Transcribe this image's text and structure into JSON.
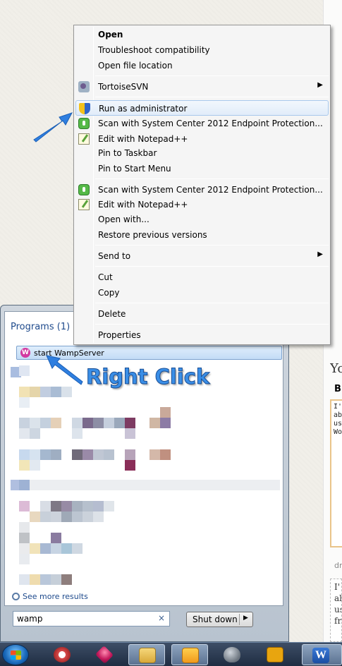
{
  "context_menu": {
    "items": [
      {
        "label": "Open",
        "bold": true,
        "icon": null
      },
      {
        "label": "Troubleshoot compatibility",
        "icon": null
      },
      {
        "label": "Open file location",
        "icon": null
      },
      {
        "label": "TortoiseSVN",
        "icon": "tortoisesvn-icon",
        "submenu": "▶"
      },
      {
        "label": "Run as administrator",
        "icon": "uac-shield-icon",
        "highlighted": true
      },
      {
        "label": "Scan with System Center 2012 Endpoint Protection...",
        "icon": "scep-icon"
      },
      {
        "label": "Edit with Notepad++",
        "icon": "notepadpp-icon"
      },
      {
        "label": "Pin to Taskbar",
        "icon": null
      },
      {
        "label": "Pin to Start Menu",
        "icon": null
      },
      {
        "label": "Scan with System Center 2012 Endpoint Protection...",
        "icon": "scep-icon"
      },
      {
        "label": "Edit with Notepad++",
        "icon": "notepadpp-icon"
      },
      {
        "label": "Open with...",
        "icon": null
      },
      {
        "label": "Restore previous versions",
        "icon": null
      },
      {
        "label": "Send to",
        "icon": null,
        "submenu": "▶"
      },
      {
        "label": "Cut",
        "icon": null
      },
      {
        "label": "Copy",
        "icon": null
      },
      {
        "label": "Delete",
        "icon": null
      },
      {
        "label": "Properties",
        "icon": null
      }
    ]
  },
  "start_menu": {
    "programs_heading": "Programs (1)",
    "result_label": "start WampServer",
    "see_more": "See more results",
    "search_value": "wamp",
    "clear_glyph": "×",
    "shutdown_label": "Shut down",
    "shutdown_arrow": "▶"
  },
  "annotation": {
    "label": "Right Click"
  },
  "right_page": {
    "title": "Yo",
    "bold": "B",
    "code_lines": [
      "I'",
      "ab",
      "us",
      "Wo"
    ],
    "sub": "dr",
    "text_lines": [
      "I'",
      "al",
      "us",
      "fr"
    ]
  },
  "taskbar": {
    "apps": [
      "start-orb",
      "snipping-tool-icon",
      "ruby-gem-icon",
      "explorer-icon",
      "outlook-icon",
      "evernote-icon",
      "filezilla-icon",
      "word-icon"
    ],
    "word_glyph": "W"
  },
  "colors": {
    "highlight_border": "#a8c8ec",
    "annotation_blue": "#3a8ee6",
    "start_menu_heading": "#1e4a8c"
  }
}
